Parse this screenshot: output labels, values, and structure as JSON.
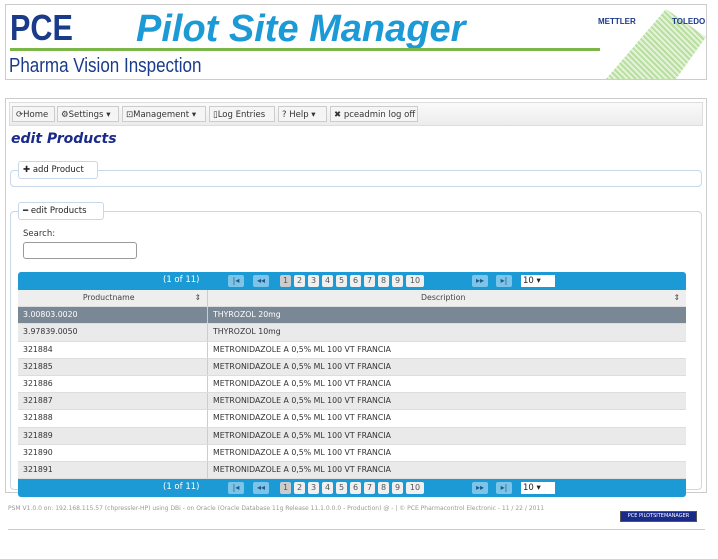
{
  "header": {
    "logo": "PCE",
    "title": "Pilot Site Manager",
    "subtitle": "Pharma Vision Inspection",
    "brand_left": "METTLER",
    "brand_right": "TOLEDO"
  },
  "toolbar": [
    {
      "icon": "refresh-icon",
      "label": "Home"
    },
    {
      "icon": "gear-icon",
      "label": "Settings"
    },
    {
      "icon": "management-icon",
      "label": "Management"
    },
    {
      "icon": "document-icon",
      "label": "Log Entries"
    },
    {
      "icon": "question-icon",
      "label": "Help"
    },
    {
      "icon": "close-icon",
      "label": "pceadmin log off"
    }
  ],
  "page_title": "edit Products",
  "add_product": {
    "label": "add Product",
    "icon": "plus-icon"
  },
  "edit_products": {
    "label": "edit Products",
    "icon": "minus-icon",
    "search_label": "Search:",
    "search_value": ""
  },
  "pager": {
    "status": "(1 of 11)",
    "pages": [
      "1",
      "2",
      "3",
      "4",
      "5",
      "6",
      "7",
      "8",
      "9",
      "10"
    ],
    "current": "1",
    "rows_per_page": "10"
  },
  "table": {
    "columns": [
      "Productname",
      "Description"
    ],
    "rows": [
      [
        "3.00803.0020",
        "THYROZOL 20mg"
      ],
      [
        "3.97839.0050",
        "THYROZOL 10mg"
      ],
      [
        "321884",
        "METRONIDAZOLE A 0,5% ML 100 VT FRANCIA"
      ],
      [
        "321885",
        "METRONIDAZOLE A 0,5% ML 100 VT FRANCIA"
      ],
      [
        "321886",
        "METRONIDAZOLE A 0,5% ML 100 VT FRANCIA"
      ],
      [
        "321887",
        "METRONIDAZOLE A 0,5% ML 100 VT FRANCIA"
      ],
      [
        "321888",
        "METRONIDAZOLE A 0,5% ML 100 VT FRANCIA"
      ],
      [
        "321889",
        "METRONIDAZOLE A 0,5% ML 100 VT FRANCIA"
      ],
      [
        "321890",
        "METRONIDAZOLE A 0,5% ML 100 VT FRANCIA"
      ],
      [
        "321891",
        "METRONIDAZOLE A 0,5% ML 100 VT FRANCIA"
      ]
    ]
  },
  "footer": {
    "text": "PSM V1.0.0 on: 192.168.115.57 (chpressler-HP) using DBi - on Oracle (Oracle Database 11g Release 11.1.0.0.0 - Production) @ - | © PCE Pharmacontrol Electronic - 11 / 22 / 2011",
    "badge": "PCE PILOTSITEMANAGER"
  },
  "colors": {
    "accent": "#1b9ad6",
    "brand_dark": "#1a3a8a",
    "green": "#7ab648",
    "selected_row": "#7a8794"
  }
}
